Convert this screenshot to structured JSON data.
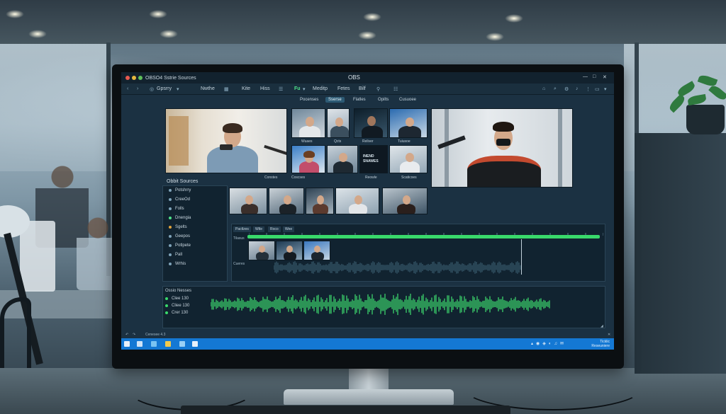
{
  "window": {
    "app_title": "OBSO4 Sstrie Sources",
    "title": "OBS",
    "controls": [
      "—",
      "□",
      "✕"
    ]
  },
  "menu": {
    "items": [
      "Gpsrry",
      "Nwthe",
      "Kite",
      "Hiss",
      "Fu",
      "Meditp",
      "Fetes",
      "Bilf"
    ]
  },
  "scenes": {
    "tabs": [
      "Pocenses",
      "Sserse",
      "Flatles",
      "Opilts",
      "Cusuoee"
    ],
    "active": 1
  },
  "thumbnail_captions": {
    "row1": [
      "Wuaes",
      "Qcts",
      "Reliver",
      "Tuiusoe"
    ],
    "row2": [
      "Constes",
      "Coscses",
      "Reowle",
      "Scaticoes"
    ],
    "overlay": [
      "INEND",
      "SNAWES"
    ]
  },
  "sources": {
    "title": "Obbit Sources",
    "items": [
      {
        "label": "Potshrry",
        "color": "blue"
      },
      {
        "label": "CreeOd",
        "color": "blue"
      },
      {
        "label": "Folls",
        "color": "blue"
      },
      {
        "label": "Dnengia",
        "color": "green"
      },
      {
        "label": "Sgelts",
        "color": "orange"
      },
      {
        "label": "Geepos",
        "color": "blue"
      },
      {
        "label": "Potlpete",
        "color": "blue"
      },
      {
        "label": "Pall",
        "color": "blue"
      },
      {
        "label": "Wrhis",
        "color": "blue"
      }
    ]
  },
  "timeline": {
    "tabs": [
      "Pactlzes",
      "Wtle",
      "Roco",
      "Wee"
    ],
    "row_labels": [
      "Tilasus",
      "Cueres"
    ]
  },
  "audio": {
    "title": "Ossio Nesses",
    "channels": [
      "Clee 130",
      "Cliee 130",
      "Crer 130"
    ]
  },
  "status": {
    "text": "Cenesee 4.3"
  },
  "tray": {
    "line1": "Ticklic",
    "line2": "Reseuniere"
  },
  "colors": {
    "accent_green": "#39d96b",
    "ui_background": "#1b3142",
    "taskbar_blue": "#1478d4"
  }
}
